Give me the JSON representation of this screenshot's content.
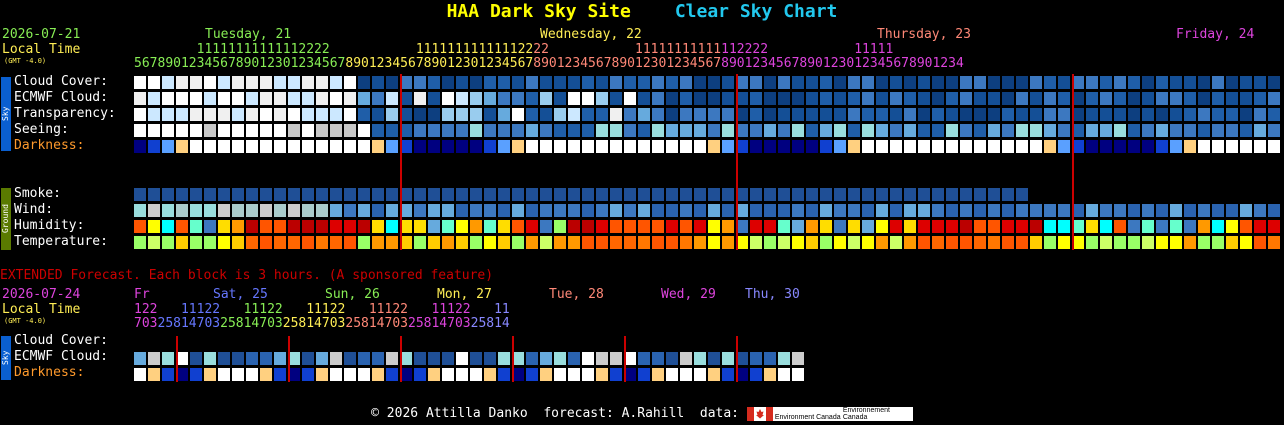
{
  "title": {
    "site": "HAA Dark Sky Site",
    "chart": "Clear Sky Chart"
  },
  "main": {
    "date": "2026-07-21",
    "local_time": "Local Time",
    "gmt": "(GMT -4.0)",
    "days": [
      {
        "label": "Tuesday, 21",
        "color": "#88ee55"
      },
      {
        "label": "Wednesday, 22",
        "color": "#ffee55"
      },
      {
        "label": "Thursday, 23",
        "color": "#ff8877"
      },
      {
        "label": "Friday, 24",
        "color": "#dd44dd"
      }
    ],
    "hour_tens": "        11111111111112222           11111111111112222           11111111111112222           11111",
    "hour_ones": "5678901234567890123012345678901234567890123012345678901234567890123012345678901234567890123012345678901234",
    "rows": [
      {
        "label": "Cloud Cover:"
      },
      {
        "label": "ECMWF Cloud:"
      },
      {
        "label": "Transparency:"
      },
      {
        "label": "Seeing:"
      },
      {
        "label": "Darkness:"
      },
      {
        "label": "Smoke:"
      },
      {
        "label": "Wind:"
      },
      {
        "label": "Humidity:"
      },
      {
        "label": "Temperature:"
      }
    ],
    "sky_tag": "Sky",
    "ground_tag": "Ground"
  },
  "extended": {
    "note": "EXTENDED Forecast. Each block is 3 hours. (A sponsored feature)",
    "date": "2026-07-24",
    "local_time": "Local Time",
    "gmt": "(GMT -4.0)",
    "days": [
      {
        "label": "Fr",
        "color": "#dd44dd"
      },
      {
        "label": "Sat, 25",
        "color": "#6677ff"
      },
      {
        "label": "Sun, 26",
        "color": "#88ee55"
      },
      {
        "label": "Mon, 27",
        "color": "#ffee55"
      },
      {
        "label": "Tue, 28",
        "color": "#ff8877"
      },
      {
        "label": "Wed, 29",
        "color": "#dd44dd"
      },
      {
        "label": "Thu, 30",
        "color": "#8888ff"
      }
    ],
    "hour_tens": "122   11122   11122   11122   11122   11122   11",
    "hour_ones": "703258147032581470325814703258147032581470325814",
    "rows": [
      {
        "label": "Cloud Cover:"
      },
      {
        "label": "ECMWF Cloud:"
      },
      {
        "label": "Darkness:"
      }
    ],
    "sky_tag": "Sky"
  },
  "footer": {
    "text": "© 2026 Attilla Danko  forecast: A.Rahill  data:",
    "agency_en": "Environment Canada",
    "agency_fr": "Environnement Canada"
  },
  "colors": {
    "accent_red": "#cc0000",
    "sky_tag": "#0a5fd0",
    "ground_tag": "#5a7a00"
  }
}
